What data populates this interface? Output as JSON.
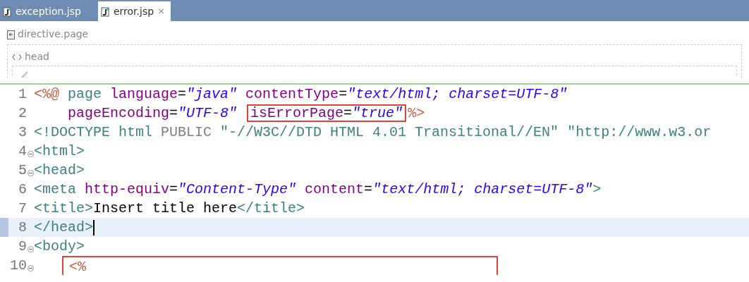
{
  "tabs": [
    {
      "label": "exception.jsp",
      "selected": false,
      "closable": false
    },
    {
      "label": "error.jsp",
      "selected": true,
      "closable": true,
      "close": "×"
    }
  ],
  "breadcrumb": [
    {
      "label": "directive.page",
      "kind": "directive"
    },
    {
      "label": "head",
      "kind": "element"
    }
  ],
  "editor": {
    "lines": [
      {
        "number": "1",
        "foldable": false,
        "current": false,
        "boxed": false,
        "tokens": [
          {
            "kind": "jsp",
            "text": "<%@"
          },
          {
            "kind": "tag",
            "text": " page"
          },
          {
            "kind": "attr",
            "text": " language"
          },
          {
            "kind": "text",
            "text": "="
          },
          {
            "kind": "str",
            "text": "\"java\""
          },
          {
            "kind": "attr",
            "text": " contentType"
          },
          {
            "kind": "text",
            "text": "="
          },
          {
            "kind": "str",
            "text": "\"text/html; charset=UTF-8\""
          }
        ]
      },
      {
        "number": "2",
        "foldable": false,
        "current": false,
        "boxed": false,
        "tokens": [
          {
            "kind": "attr",
            "text": "    pageEncoding"
          },
          {
            "kind": "text",
            "text": "="
          },
          {
            "kind": "str",
            "text": "\"UTF-8\" "
          },
          {
            "kind": "group",
            "highlight": true,
            "tokens": [
              {
                "kind": "attr",
                "text": "isErrorPage"
              },
              {
                "kind": "text",
                "text": "="
              },
              {
                "kind": "str",
                "text": "\"true\""
              }
            ]
          },
          {
            "kind": "jsp",
            "text": "%>"
          }
        ]
      },
      {
        "number": "3",
        "foldable": false,
        "current": false,
        "boxed": false,
        "tokens": [
          {
            "kind": "tag",
            "text": "<!DOCTYPE html"
          },
          {
            "kind": "keyword",
            "text": " PUBLIC "
          },
          {
            "kind": "tag",
            "text": "\"-//W3C//DTD HTML 4.01 Transitional//EN\" \"http://www.w3.or"
          }
        ]
      },
      {
        "number": "4",
        "foldable": true,
        "current": false,
        "boxed": false,
        "tokens": [
          {
            "kind": "tag",
            "text": "<html>"
          }
        ]
      },
      {
        "number": "5",
        "foldable": true,
        "current": false,
        "boxed": false,
        "tokens": [
          {
            "kind": "tag",
            "text": "<head>"
          }
        ]
      },
      {
        "number": "6",
        "foldable": false,
        "current": false,
        "boxed": false,
        "tokens": [
          {
            "kind": "tag",
            "text": "<meta"
          },
          {
            "kind": "attr",
            "text": " http-equiv"
          },
          {
            "kind": "text",
            "text": "="
          },
          {
            "kind": "str",
            "text": "\"Content-Type\""
          },
          {
            "kind": "attr",
            "text": " content"
          },
          {
            "kind": "text",
            "text": "="
          },
          {
            "kind": "str",
            "text": "\"text/html; charset=UTF-8\""
          },
          {
            "kind": "tag",
            "text": ">"
          }
        ]
      },
      {
        "number": "7",
        "foldable": false,
        "current": false,
        "boxed": false,
        "tokens": [
          {
            "kind": "tag",
            "text": "<title>"
          },
          {
            "kind": "text",
            "text": "Insert title here"
          },
          {
            "kind": "tag",
            "text": "</title>"
          }
        ]
      },
      {
        "number": "8",
        "foldable": false,
        "current": true,
        "boxed": false,
        "tokens": [
          {
            "kind": "tag",
            "text": "</head>"
          }
        ]
      },
      {
        "number": "9",
        "foldable": true,
        "current": false,
        "boxed": false,
        "tokens": [
          {
            "kind": "tag",
            "text": "<body>"
          }
        ]
      },
      {
        "number": "10",
        "foldable": true,
        "current": false,
        "boxed": true,
        "tokens": [
          {
            "kind": "jsp",
            "text": "<%"
          }
        ]
      }
    ]
  }
}
